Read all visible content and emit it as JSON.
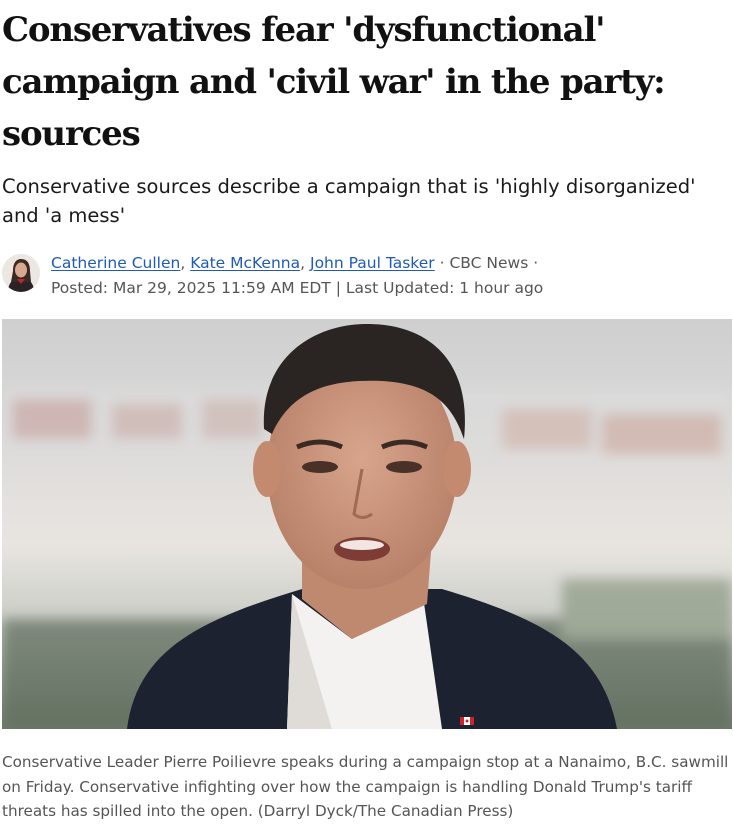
{
  "article": {
    "headline": "Conservatives fear 'dysfunctional' campaign and 'civil war' in the party: sources",
    "dek": "Conservative sources describe a campaign that is 'highly disorganized' and 'a mess'"
  },
  "byline": {
    "authors": [
      "Catherine Cullen",
      "Kate McKenna",
      "John Paul Tasker"
    ],
    "author_separator": ",",
    "source": "CBC News",
    "dot": "·",
    "posted": "Posted: Mar 29, 2025 11:59 AM EDT",
    "divider": "|",
    "updated": "Last Updated: 1 hour ago"
  },
  "photo": {
    "caption": "Conservative Leader Pierre Poilievre speaks during a campaign stop at a Nanaimo, B.C. sawmill on Friday. Conservative infighting over how the campaign is handling Donald Trump's tariff threats has spilled into the open. (Darryl Dyck/The Canadian Press)"
  },
  "colors": {
    "link": "#1f5bb5",
    "meta_text": "#555555",
    "headline": "#111111"
  }
}
